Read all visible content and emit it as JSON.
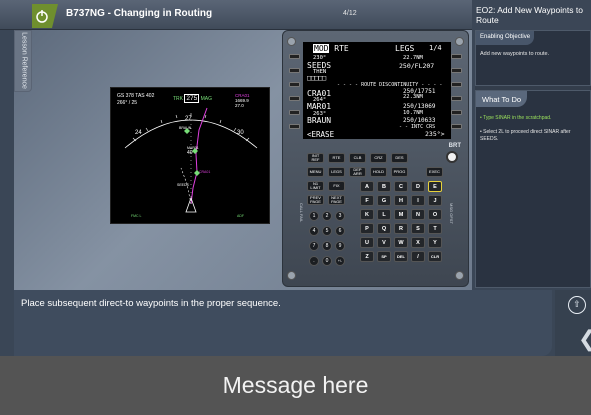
{
  "header": {
    "course_title": "B737NG - Changing in Routing",
    "page_indicator": "4/12",
    "objective_title": "EO2: Add New Waypoints to Route"
  },
  "sidebar_tab": {
    "label": "Lesson Reference"
  },
  "nd": {
    "gs_label": "GS",
    "gs_value": "378",
    "tas_label": "TAS",
    "tas_value": "402",
    "wind": "266° / 25",
    "trk_label": "TRK",
    "heading": "275",
    "mag_label": "MAG",
    "active_wpt": "CRA01",
    "wpt_dist": "1669.9",
    "wpt_eta": "27.0",
    "compass": [
      "24",
      "27",
      "30"
    ],
    "waypoints": [
      "BRAUN",
      "MAR01",
      "CRA01",
      "SEEDS"
    ],
    "range_marks": [
      "40",
      "20"
    ],
    "bottom_left": "FMC L",
    "bottom_right": "ADF"
  },
  "cdu": {
    "screen": {
      "title_mod": "MOD",
      "title_rte": "RTE",
      "title_legs": "LEGS",
      "page": "1/4",
      "line1_small_left": "230°",
      "line1_small_right": "22.7NM",
      "line1_left": "SEEDS",
      "line1_right": "250/FL207",
      "line2_small_left": "THEN",
      "line2_left": "□□□□□",
      "discontinuity": "ROUTE DISCONTINUITY",
      "line3_left": "CRA01",
      "line3_right": "250/17751",
      "line3_small_left": "264°",
      "line3_small_right": "22.3NM",
      "line4_left": "MAR01",
      "line4_right": "250/13069",
      "line4_small_left": "263°",
      "line4_small_right": "10.7NM",
      "line5_left": "BRAUN",
      "line5_right": "250/10633",
      "intc_crs": "INTC CRS",
      "line6_left": "<ERASE",
      "line6_right": "235°>"
    },
    "brt": "BRT",
    "func_row1": [
      "INIT REF",
      "RTE",
      "CLB",
      "CRZ",
      "DES"
    ],
    "func_row2": [
      "MENU",
      "LEGS",
      "DEP ARR",
      "HOLD",
      "PROG",
      "EXEC"
    ],
    "func_row3": [
      "N1 LIMIT",
      "FIX"
    ],
    "func_row4": [
      "PREV PAGE",
      "NEXT PAGE"
    ],
    "letters": [
      "A",
      "B",
      "C",
      "D",
      "E",
      "F",
      "G",
      "H",
      "I",
      "J",
      "K",
      "L",
      "M",
      "N",
      "O",
      "P",
      "Q",
      "R",
      "S",
      "T",
      "U",
      "V",
      "W",
      "X",
      "Y",
      "Z",
      "SP",
      "DEL",
      "/",
      "CLR"
    ],
    "numbers": [
      "1",
      "2",
      "3",
      "4",
      "5",
      "6",
      "7",
      "8",
      "9",
      ".",
      "0",
      "+/-"
    ],
    "annun_left": "CALL FAIL",
    "annun_right": "MSG OFST"
  },
  "right_panel": {
    "enabling_title": "Enabling Objective",
    "enabling_body": "Add new waypoints to route.",
    "todo_title": "What To Do",
    "steps": [
      "Type SINAR in the scratchpad.",
      "Select 2L to proceed direct SINAR after SEEDS."
    ]
  },
  "message": {
    "text": "Place subsequent direct-to waypoints in the proper sequence.",
    "banner": "Message here"
  },
  "nav": {
    "next_icon": "⇧",
    "back_icon": "❮"
  }
}
